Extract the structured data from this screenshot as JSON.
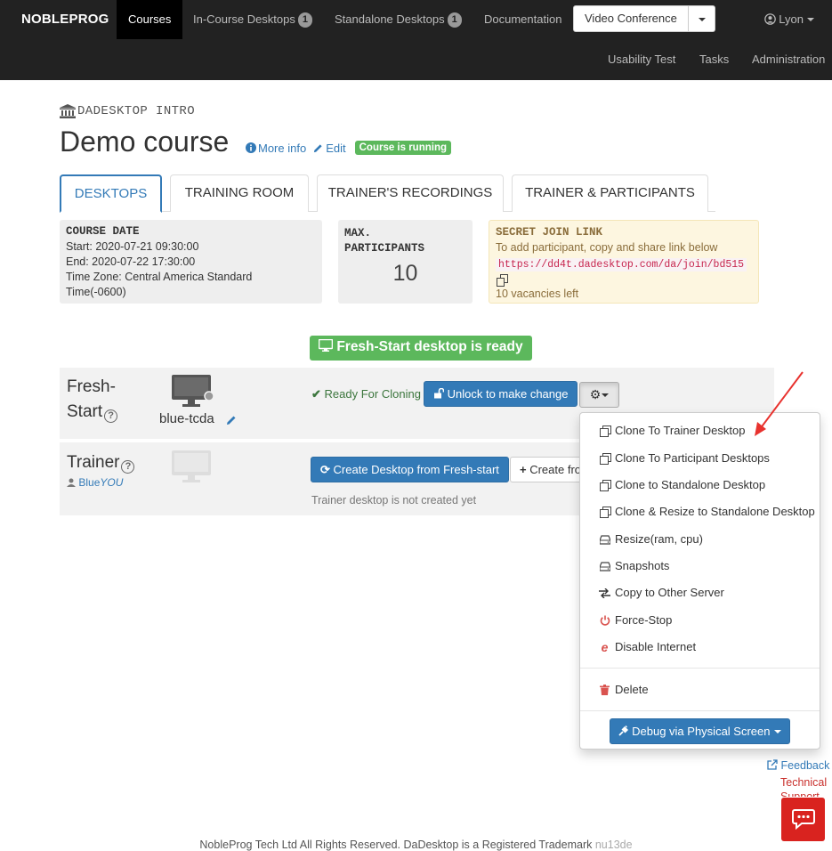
{
  "navbar": {
    "brand": "NOBLEPROG",
    "items": [
      {
        "label": "Courses"
      },
      {
        "label": "In-Course Desktops",
        "badge": "1"
      },
      {
        "label": "Standalone Desktops",
        "badge": "1"
      },
      {
        "label": "Documentation"
      }
    ],
    "video_conference": "Video Conference",
    "user": "Lyon",
    "secondary": [
      "Usability Test",
      "Tasks",
      "Administration"
    ]
  },
  "breadcrumb": "DADESKTOP INTRO",
  "course": {
    "title": "Demo course",
    "more_info": "More info",
    "edit": "Edit",
    "status": "Course is running"
  },
  "tabs": [
    "DESKTOPS",
    "TRAINING ROOM",
    "TRAINER'S RECORDINGS",
    "TRAINER & PARTICIPANTS"
  ],
  "course_date": {
    "heading": "COURSE DATE",
    "start": "Start: 2020-07-21 09:30:00",
    "end": "End: 2020-07-22 17:30:00",
    "timezone_1": "Time Zone: Central America Standard",
    "timezone_2": "Time(-0600)"
  },
  "max_participants": {
    "heading_1": "MAX.",
    "heading_2": "PARTICIPANTS",
    "value": "10"
  },
  "secret_link": {
    "heading": "SECRET JOIN LINK",
    "instruction": "To add participant, copy and share link below",
    "url": "https://dd4t.dadesktop.com/da/join/bd515",
    "vacancies": "10 vacancies left"
  },
  "fresh_start_banner": "Fresh-Start desktop is ready",
  "fresh_row": {
    "name_1": "Fresh-",
    "name_2": "Start",
    "desktop_name": "blue-tcda",
    "status": "Ready For Cloning",
    "unlock_button": "Unlock to make change"
  },
  "trainer_row": {
    "name": "Trainer",
    "user_prefix": "Blue",
    "user_suffix": "YOU",
    "create_button": "Create Desktop from Fresh-start",
    "create_other_button": "Create fro",
    "note": "Trainer desktop is not created yet"
  },
  "dropdown": {
    "items": [
      {
        "label": "Clone To Trainer Desktop",
        "icon": "clone-icon"
      },
      {
        "label": "Clone To Participant Desktops",
        "icon": "clone-icon"
      },
      {
        "label": "Clone to Standalone Desktop",
        "icon": "clone-icon"
      },
      {
        "label": "Clone & Resize to Standalone Desktop",
        "icon": "clone-icon"
      },
      {
        "label": "Resize(ram, cpu)",
        "icon": "hdd-icon"
      },
      {
        "label": "Snapshots",
        "icon": "hdd-icon"
      },
      {
        "label": "Copy to Other Server",
        "icon": "transfer-icon"
      },
      {
        "label": "Force-Stop",
        "icon": "power-icon"
      },
      {
        "label": "Disable Internet",
        "icon": "ie-icon"
      }
    ],
    "delete": "Delete",
    "debug": "Debug via Physical Screen"
  },
  "side_links": {
    "feedback": "Feedback",
    "tech_1": "Technical",
    "tech_2": "Support"
  },
  "footer": {
    "text": "NobleProg Tech Ltd All Rights Reserved. DaDesktop is a Registered Trademark",
    "version": "nu13de"
  },
  "colors": {
    "primary": "#337ab7",
    "success": "#5cb85c",
    "danger": "#d9534f",
    "navbar": "#222222"
  }
}
